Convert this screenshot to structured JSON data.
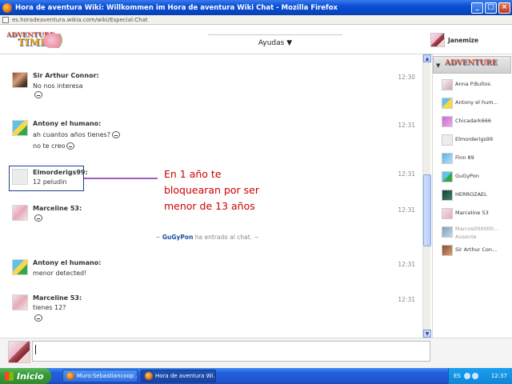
{
  "window": {
    "title": "Hora de aventura Wiki: Willkommen im Hora de aventura Wiki Chat - Mozilla Firefox",
    "url": "es.horadeaventura.wikia.com/wiki/Especial:Chat"
  },
  "header": {
    "logo_line1": "ADVENTURE",
    "logo_line2": "TIME",
    "ayudas": "Ayudas ▼",
    "current_user": "Janemize"
  },
  "messages": [
    {
      "user": "Sir Arthur Connor:",
      "lines": [
        "No nos interesa"
      ],
      "time": "12:30"
    },
    {
      "user": "Antony el humano:",
      "lines": [
        "ah cuantos años tienes?",
        "no te creo"
      ],
      "time": "12:31"
    },
    {
      "user": "Elmorderigs99:",
      "lines": [
        "12 peludin"
      ],
      "time": "12:31"
    },
    {
      "user": "Marceline 53:",
      "lines": [],
      "time": "12:31"
    },
    {
      "user": "Antony el humano:",
      "lines": [
        "menor detected!"
      ],
      "time": "12:31"
    },
    {
      "user": "Marceline 53:",
      "lines": [
        "tienes 12?"
      ],
      "time": "12:31"
    }
  ],
  "system_message": {
    "prefix": "~ ",
    "user": "GuGyPon",
    "text": " ha entrado al chat. ~"
  },
  "annotation": "En 1 año te\nbloquearan por ser\nmenor de 13 años",
  "sidebar": {
    "users": [
      {
        "name": "Anna P.Bultos"
      },
      {
        "name": "Antony el hum..."
      },
      {
        "name": "Chicadark666"
      },
      {
        "name": "Elmorderigs99"
      },
      {
        "name": "Finn 89"
      },
      {
        "name": "GuGyPon"
      },
      {
        "name": "HERROZAEL"
      },
      {
        "name": "Marceline 53"
      },
      {
        "name": "Marcos000000...",
        "status": "Ausente"
      },
      {
        "name": "Sir Arthur Con..."
      }
    ]
  },
  "taskbar": {
    "start": "Inicio",
    "tasks": [
      "Muro:Sebastiancoop ...",
      "Hora de aventura Wi..."
    ],
    "language": "ES",
    "clock": "12:37"
  }
}
